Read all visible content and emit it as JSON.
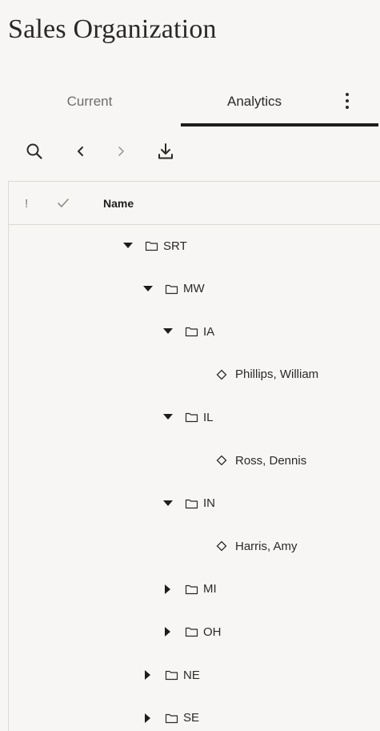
{
  "page": {
    "title": "Sales Organization"
  },
  "tabs": [
    {
      "label": "Current",
      "selected": false
    },
    {
      "label": "Analytics",
      "selected": true
    }
  ],
  "toolbar": {
    "icons": [
      "search-icon",
      "chevron-left-icon",
      "chevron-right-icon",
      "download-icon"
    ]
  },
  "table": {
    "columns": {
      "error": "!",
      "status": "check-icon",
      "name": "Name"
    },
    "rows": [
      {
        "label": "SRT",
        "type": "folder",
        "expanded": true
      },
      {
        "label": "MW",
        "type": "folder",
        "expanded": true
      },
      {
        "label": "IA",
        "type": "folder",
        "expanded": true
      },
      {
        "label": "Phillips, William",
        "type": "person"
      },
      {
        "label": "IL",
        "type": "folder",
        "expanded": true
      },
      {
        "label": "Ross, Dennis",
        "type": "person"
      },
      {
        "label": "IN",
        "type": "folder",
        "expanded": true
      },
      {
        "label": "Harris, Amy",
        "type": "person"
      },
      {
        "label": "MI",
        "type": "folder",
        "expanded": false
      },
      {
        "label": "OH",
        "type": "folder",
        "expanded": false
      },
      {
        "label": "NE",
        "type": "folder",
        "expanded": false
      },
      {
        "label": "SE",
        "type": "folder",
        "expanded": false
      }
    ]
  }
}
